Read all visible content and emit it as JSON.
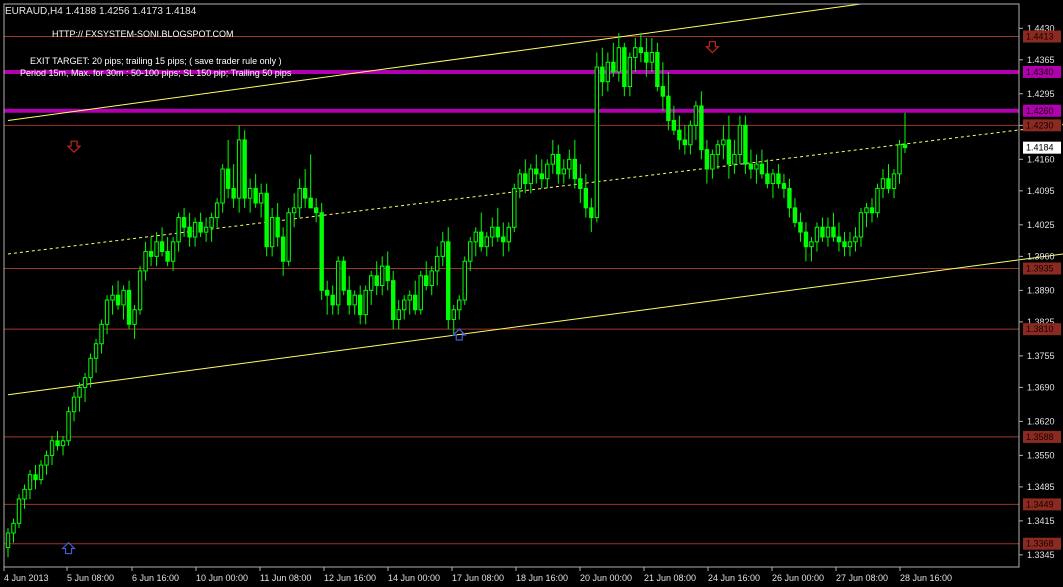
{
  "window": {
    "symbol": "EURAUD,H4",
    "ohlc": "1.4188 1.4256 1.4173 1.4184"
  },
  "annotations": {
    "site": "HTTP:// FXSYSTEM-SONI.BLOGSPOT.COM",
    "exit_target": "EXIT TARGET: 20 pips; trailing 15 pips; ( save trader rule only )",
    "period": "Period 15m, Max. for 30m  : 50-100 pips; SL 150 pip; Trailing 50 pips"
  },
  "colors": {
    "background": "#000000",
    "candle": "#00ff00",
    "grid_frame": "#b0b0b0",
    "channel": "#ffff66",
    "level_line": "#a0352a",
    "level_label_bg": "#8b2a20",
    "magenta_line": "#b000b0",
    "down_arrow": "#c0281e",
    "up_arrow": "#3f5fd6",
    "current_price_bg": "#ffffff"
  },
  "chart_data": {
    "type": "candlestick",
    "ylim": [
      1.332,
      1.448
    ],
    "yticks": [
      "1.4430",
      "1.4365",
      "1.4295",
      "1.4230",
      "1.4160",
      "1.4095",
      "1.4025",
      "1.3960",
      "1.3890",
      "1.3825",
      "1.3755",
      "1.3690",
      "1.3620",
      "1.3550",
      "1.3485",
      "1.3415",
      "1.3345"
    ],
    "xticks": [
      "4 Jun 2013",
      "5 Jun 08:00",
      "6 Jun 16:00",
      "10 Jun 00:00",
      "11 Jun 08:00",
      "12 Jun 16:00",
      "14 Jun 00:00",
      "17 Jun 08:00",
      "18 Jun 16:00",
      "20 Jun 00:00",
      "21 Jun 08:00",
      "24 Jun 16:00",
      "26 Jun 00:00",
      "27 Jun 08:00",
      "28 Jun 16:00"
    ],
    "current_price": "1.4184",
    "levels": [
      {
        "label": "1.4413",
        "kind": "level"
      },
      {
        "label": "1.4340",
        "kind": "magenta"
      },
      {
        "label": "1.4260",
        "kind": "magenta"
      },
      {
        "label": "1.4230",
        "kind": "level"
      },
      {
        "label": "1.3935",
        "kind": "level"
      },
      {
        "label": "1.3810",
        "kind": "level"
      },
      {
        "label": "1.3588",
        "kind": "level"
      },
      {
        "label": "1.3449",
        "kind": "level"
      },
      {
        "label": "1.3368",
        "kind": "level"
      }
    ],
    "channel_lines": [
      {
        "style": "solid",
        "from": [
          0,
          1.424
        ],
        "to": [
          155,
          1.448
        ]
      },
      {
        "style": "dashed",
        "from": [
          0,
          1.3965
        ],
        "to": [
          205,
          1.425
        ]
      },
      {
        "style": "solid",
        "from": [
          0,
          1.3675
        ],
        "to": [
          205,
          1.3985
        ]
      }
    ],
    "arrows": [
      {
        "dir": "down",
        "index": 12,
        "price": 1.4185
      },
      {
        "dir": "down",
        "index": 128,
        "price": 1.439
      },
      {
        "dir": "up",
        "index": 82,
        "price": 1.38
      },
      {
        "dir": "up",
        "index": 11,
        "price": 1.336
      }
    ],
    "bars": [
      [
        1.336,
        1.34,
        1.334,
        1.339
      ],
      [
        1.339,
        1.342,
        1.337,
        1.341
      ],
      [
        1.341,
        1.347,
        1.34,
        1.346
      ],
      [
        1.346,
        1.349,
        1.344,
        1.348
      ],
      [
        1.348,
        1.352,
        1.346,
        1.351
      ],
      [
        1.351,
        1.353,
        1.348,
        1.35
      ],
      [
        1.35,
        1.354,
        1.349,
        1.353
      ],
      [
        1.353,
        1.356,
        1.351,
        1.355
      ],
      [
        1.355,
        1.359,
        1.353,
        1.358
      ],
      [
        1.358,
        1.36,
        1.356,
        1.357
      ],
      [
        1.357,
        1.359,
        1.355,
        1.358
      ],
      [
        1.358,
        1.365,
        1.357,
        1.364
      ],
      [
        1.364,
        1.368,
        1.362,
        1.367
      ],
      [
        1.367,
        1.37,
        1.364,
        1.369
      ],
      [
        1.369,
        1.372,
        1.366,
        1.371
      ],
      [
        1.371,
        1.376,
        1.369,
        1.375
      ],
      [
        1.375,
        1.379,
        1.372,
        1.378
      ],
      [
        1.378,
        1.383,
        1.376,
        1.382
      ],
      [
        1.382,
        1.388,
        1.38,
        1.387
      ],
      [
        1.387,
        1.39,
        1.384,
        1.388
      ],
      [
        1.388,
        1.391,
        1.385,
        1.386
      ],
      [
        1.386,
        1.39,
        1.383,
        1.389
      ],
      [
        1.389,
        1.391,
        1.381,
        1.382
      ],
      [
        1.382,
        1.386,
        1.379,
        1.385
      ],
      [
        1.385,
        1.394,
        1.384,
        1.393
      ],
      [
        1.393,
        1.399,
        1.391,
        1.397
      ],
      [
        1.397,
        1.4,
        1.394,
        1.396
      ],
      [
        1.396,
        1.401,
        1.394,
        1.399
      ],
      [
        1.399,
        1.402,
        1.396,
        1.397
      ],
      [
        1.397,
        1.4,
        1.394,
        1.395
      ],
      [
        1.395,
        1.4,
        1.393,
        1.399
      ],
      [
        1.399,
        1.405,
        1.397,
        1.404
      ],
      [
        1.404,
        1.406,
        1.4,
        1.402
      ],
      [
        1.402,
        1.405,
        1.398,
        1.4
      ],
      [
        1.4,
        1.404,
        1.398,
        1.403
      ],
      [
        1.403,
        1.405,
        1.4,
        1.401
      ],
      [
        1.401,
        1.404,
        1.399,
        1.402
      ],
      [
        1.402,
        1.405,
        1.399,
        1.404
      ],
      [
        1.404,
        1.408,
        1.402,
        1.407
      ],
      [
        1.407,
        1.415,
        1.405,
        1.414
      ],
      [
        1.414,
        1.42,
        1.408,
        1.41
      ],
      [
        1.41,
        1.415,
        1.406,
        1.408
      ],
      [
        1.408,
        1.423,
        1.405,
        1.42
      ],
      [
        1.42,
        1.422,
        1.406,
        1.408
      ],
      [
        1.408,
        1.412,
        1.405,
        1.41
      ],
      [
        1.41,
        1.413,
        1.406,
        1.407
      ],
      [
        1.407,
        1.411,
        1.404,
        1.409
      ],
      [
        1.409,
        1.411,
        1.396,
        1.398
      ],
      [
        1.398,
        1.406,
        1.396,
        1.404
      ],
      [
        1.404,
        1.407,
        1.398,
        1.4
      ],
      [
        1.4,
        1.402,
        1.392,
        1.395
      ],
      [
        1.395,
        1.406,
        1.394,
        1.405
      ],
      [
        1.405,
        1.409,
        1.402,
        1.406
      ],
      [
        1.406,
        1.412,
        1.404,
        1.41
      ],
      [
        1.41,
        1.414,
        1.406,
        1.408
      ],
      [
        1.408,
        1.417,
        1.406,
        1.406
      ],
      [
        1.406,
        1.408,
        1.403,
        1.405
      ],
      [
        1.405,
        1.407,
        1.387,
        1.389
      ],
      [
        1.389,
        1.391,
        1.384,
        1.388
      ],
      [
        1.388,
        1.39,
        1.384,
        1.386
      ],
      [
        1.386,
        1.396,
        1.384,
        1.395
      ],
      [
        1.395,
        1.396,
        1.388,
        1.389
      ],
      [
        1.389,
        1.392,
        1.384,
        1.386
      ],
      [
        1.386,
        1.389,
        1.384,
        1.388
      ],
      [
        1.388,
        1.39,
        1.382,
        1.384
      ],
      [
        1.384,
        1.39,
        1.382,
        1.389
      ],
      [
        1.389,
        1.393,
        1.386,
        1.392
      ],
      [
        1.392,
        1.395,
        1.388,
        1.39
      ],
      [
        1.39,
        1.396,
        1.388,
        1.394
      ],
      [
        1.394,
        1.397,
        1.389,
        1.391
      ],
      [
        1.391,
        1.393,
        1.381,
        1.383
      ],
      [
        1.383,
        1.387,
        1.381,
        1.385
      ],
      [
        1.385,
        1.388,
        1.383,
        1.387
      ],
      [
        1.387,
        1.389,
        1.384,
        1.388
      ],
      [
        1.388,
        1.391,
        1.384,
        1.385
      ],
      [
        1.385,
        1.393,
        1.384,
        1.392
      ],
      [
        1.392,
        1.395,
        1.389,
        1.39
      ],
      [
        1.39,
        1.394,
        1.388,
        1.393
      ],
      [
        1.393,
        1.398,
        1.39,
        1.396
      ],
      [
        1.396,
        1.401,
        1.394,
        1.399
      ],
      [
        1.399,
        1.402,
        1.381,
        1.383
      ],
      [
        1.383,
        1.386,
        1.38,
        1.385
      ],
      [
        1.385,
        1.388,
        1.383,
        1.387
      ],
      [
        1.387,
        1.396,
        1.386,
        1.395
      ],
      [
        1.395,
        1.4,
        1.393,
        1.399
      ],
      [
        1.399,
        1.402,
        1.396,
        1.401
      ],
      [
        1.401,
        1.405,
        1.397,
        1.398
      ],
      [
        1.398,
        1.401,
        1.396,
        1.4
      ],
      [
        1.4,
        1.404,
        1.398,
        1.402
      ],
      [
        1.402,
        1.406,
        1.399,
        1.4
      ],
      [
        1.4,
        1.403,
        1.396,
        1.399
      ],
      [
        1.399,
        1.403,
        1.397,
        1.402
      ],
      [
        1.402,
        1.411,
        1.401,
        1.41
      ],
      [
        1.41,
        1.414,
        1.408,
        1.413
      ],
      [
        1.413,
        1.416,
        1.409,
        1.411
      ],
      [
        1.411,
        1.415,
        1.409,
        1.414
      ],
      [
        1.414,
        1.417,
        1.411,
        1.413
      ],
      [
        1.413,
        1.416,
        1.41,
        1.412
      ],
      [
        1.412,
        1.416,
        1.41,
        1.415
      ],
      [
        1.415,
        1.42,
        1.413,
        1.417
      ],
      [
        1.417,
        1.419,
        1.411,
        1.413
      ],
      [
        1.413,
        1.416,
        1.411,
        1.414
      ],
      [
        1.414,
        1.418,
        1.412,
        1.416
      ],
      [
        1.416,
        1.42,
        1.41,
        1.412
      ],
      [
        1.412,
        1.415,
        1.407,
        1.41
      ],
      [
        1.41,
        1.413,
        1.404,
        1.406
      ],
      [
        1.406,
        1.408,
        1.401,
        1.404
      ],
      [
        1.404,
        1.438,
        1.403,
        1.435
      ],
      [
        1.435,
        1.439,
        1.429,
        1.432
      ],
      [
        1.432,
        1.438,
        1.43,
        1.436
      ],
      [
        1.436,
        1.44,
        1.433,
        1.434
      ],
      [
        1.434,
        1.442,
        1.432,
        1.439
      ],
      [
        1.439,
        1.44,
        1.429,
        1.431
      ],
      [
        1.431,
        1.438,
        1.429,
        1.437
      ],
      [
        1.437,
        1.441,
        1.434,
        1.439
      ],
      [
        1.439,
        1.442,
        1.436,
        1.438
      ],
      [
        1.438,
        1.441,
        1.433,
        1.436
      ],
      [
        1.436,
        1.441,
        1.434,
        1.438
      ],
      [
        1.438,
        1.44,
        1.43,
        1.431
      ],
      [
        1.431,
        1.436,
        1.426,
        1.429
      ],
      [
        1.429,
        1.434,
        1.422,
        1.424
      ],
      [
        1.424,
        1.427,
        1.421,
        1.422
      ],
      [
        1.422,
        1.425,
        1.418,
        1.42
      ],
      [
        1.42,
        1.423,
        1.417,
        1.419
      ],
      [
        1.419,
        1.424,
        1.417,
        1.423
      ],
      [
        1.423,
        1.428,
        1.42,
        1.427
      ],
      [
        1.427,
        1.43,
        1.416,
        1.418
      ],
      [
        1.418,
        1.42,
        1.411,
        1.414
      ],
      [
        1.414,
        1.418,
        1.412,
        1.417
      ],
      [
        1.417,
        1.42,
        1.414,
        1.419
      ],
      [
        1.419,
        1.423,
        1.416,
        1.42
      ],
      [
        1.42,
        1.425,
        1.412,
        1.415
      ],
      [
        1.415,
        1.42,
        1.413,
        1.417
      ],
      [
        1.417,
        1.425,
        1.415,
        1.423
      ],
      [
        1.423,
        1.425,
        1.413,
        1.415
      ],
      [
        1.415,
        1.418,
        1.412,
        1.414
      ],
      [
        1.414,
        1.417,
        1.411,
        1.415
      ],
      [
        1.415,
        1.418,
        1.412,
        1.413
      ],
      [
        1.413,
        1.416,
        1.41,
        1.411
      ],
      [
        1.411,
        1.414,
        1.408,
        1.413
      ],
      [
        1.413,
        1.415,
        1.41,
        1.411
      ],
      [
        1.411,
        1.413,
        1.408,
        1.41
      ],
      [
        1.41,
        1.412,
        1.404,
        1.406
      ],
      [
        1.406,
        1.408,
        1.402,
        1.403
      ],
      [
        1.403,
        1.405,
        1.399,
        1.401
      ],
      [
        1.401,
        1.403,
        1.395,
        1.398
      ],
      [
        1.398,
        1.4,
        1.395,
        1.399
      ],
      [
        1.399,
        1.403,
        1.397,
        1.402
      ],
      [
        1.402,
        1.404,
        1.399,
        1.4
      ],
      [
        1.4,
        1.404,
        1.398,
        1.402
      ],
      [
        1.402,
        1.405,
        1.399,
        1.4
      ],
      [
        1.4,
        1.403,
        1.397,
        1.399
      ],
      [
        1.399,
        1.401,
        1.396,
        1.398
      ],
      [
        1.398,
        1.401,
        1.396,
        1.399
      ],
      [
        1.399,
        1.402,
        1.397,
        1.4
      ],
      [
        1.4,
        1.406,
        1.398,
        1.405
      ],
      [
        1.405,
        1.407,
        1.402,
        1.406
      ],
      [
        1.406,
        1.408,
        1.403,
        1.405
      ],
      [
        1.405,
        1.411,
        1.404,
        1.41
      ],
      [
        1.41,
        1.414,
        1.408,
        1.412
      ],
      [
        1.412,
        1.415,
        1.409,
        1.41
      ],
      [
        1.41,
        1.414,
        1.408,
        1.413
      ],
      [
        1.413,
        1.42,
        1.411,
        1.419
      ],
      [
        1.419,
        1.4256,
        1.4173,
        1.4184
      ]
    ]
  }
}
